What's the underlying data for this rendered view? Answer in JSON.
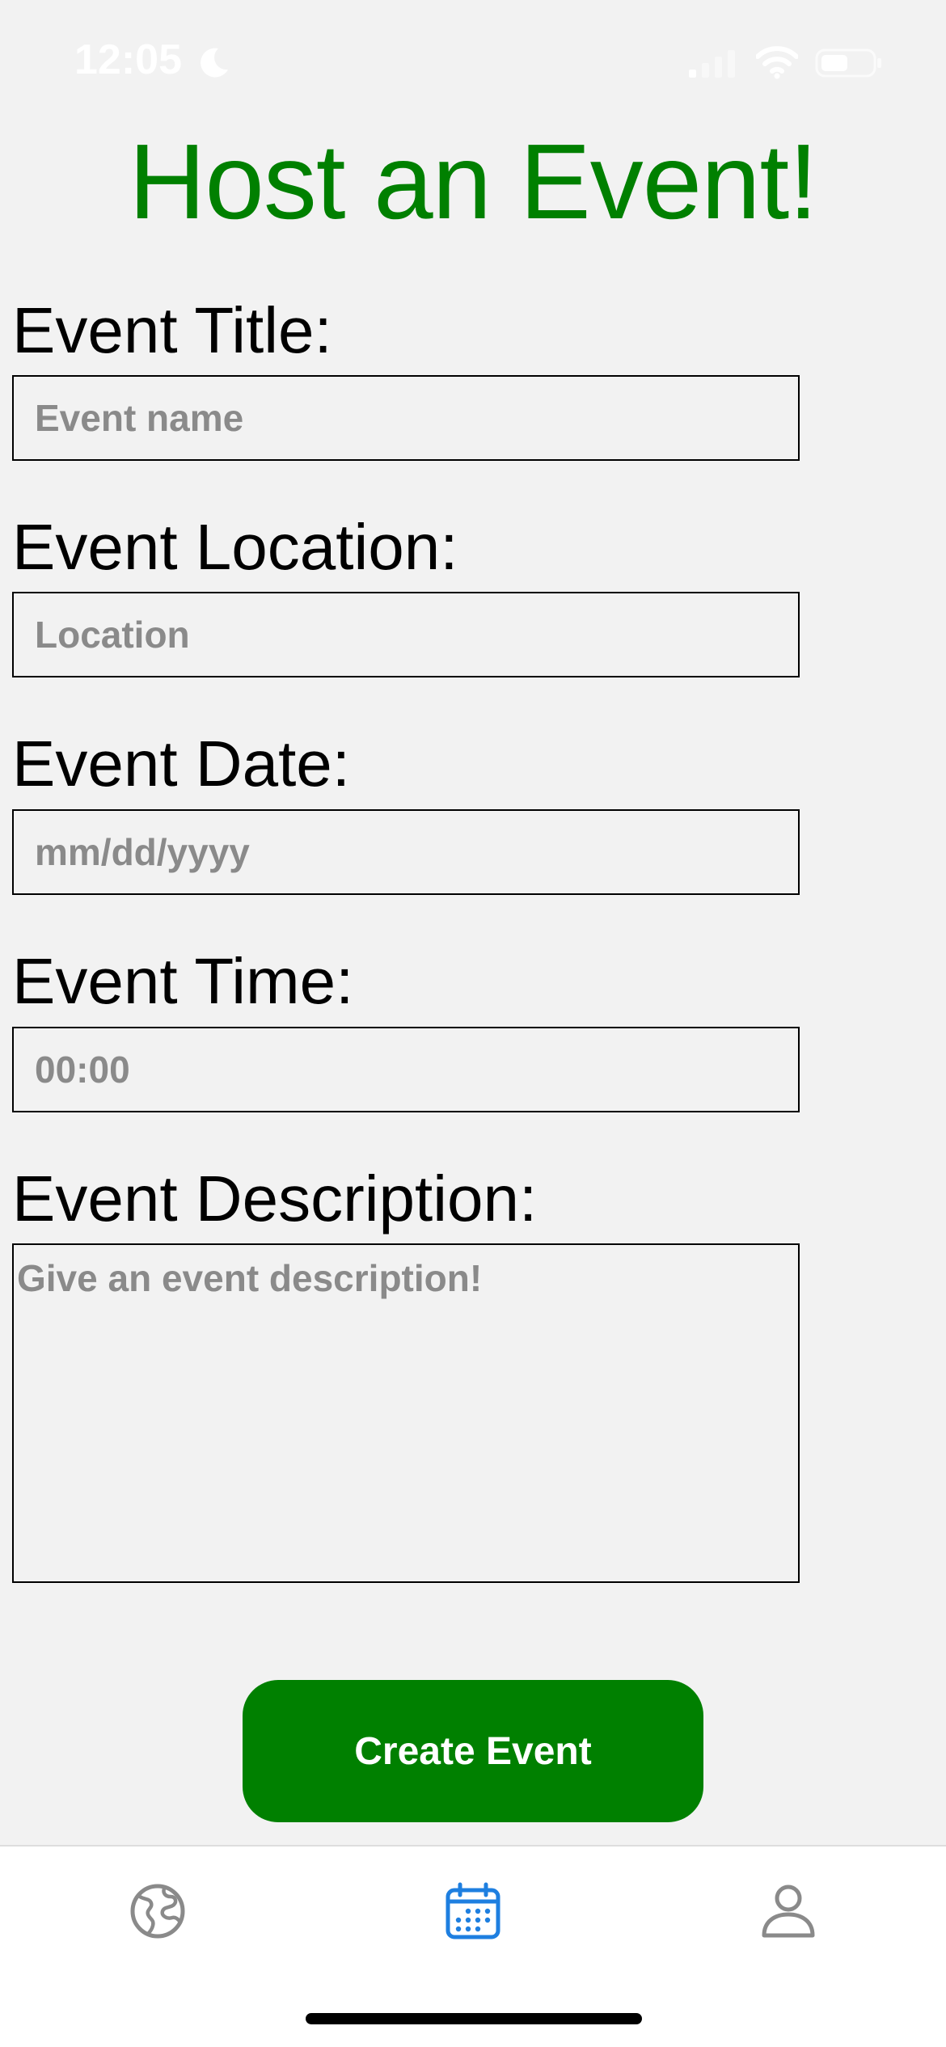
{
  "status_bar": {
    "time": "12:05"
  },
  "header": {
    "title": "Host an Event!"
  },
  "form": {
    "title": {
      "label": "Event Title:",
      "placeholder": "Event name",
      "value": ""
    },
    "location": {
      "label": "Event Location:",
      "placeholder": "Location",
      "value": ""
    },
    "date": {
      "label": "Event Date:",
      "placeholder": "mm/dd/yyyy",
      "value": ""
    },
    "time": {
      "label": "Event Time:",
      "placeholder": "00:00",
      "value": ""
    },
    "description": {
      "label": "Event Description:",
      "placeholder": "Give an event description!",
      "value": ""
    },
    "submit_label": "Create Event"
  },
  "tab_bar": {
    "tabs": [
      {
        "icon": "globe-icon",
        "active": false
      },
      {
        "icon": "calendar-icon",
        "active": true
      },
      {
        "icon": "person-icon",
        "active": false
      }
    ],
    "active_color": "#1e7fe0",
    "inactive_color": "#8a8a8a"
  },
  "colors": {
    "accent": "#008000",
    "background": "#f2f2f2"
  }
}
